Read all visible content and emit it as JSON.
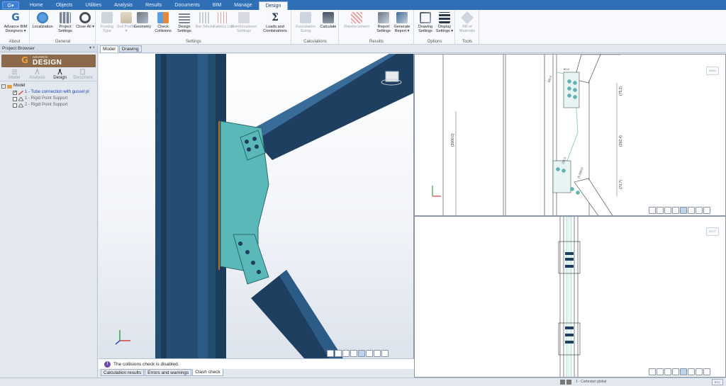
{
  "app": {
    "menu_button": "G▾"
  },
  "menu": {
    "tabs": [
      "Home",
      "Objects",
      "Utilities",
      "Analysis",
      "Results",
      "Documents",
      "BIM",
      "Manage",
      "Design"
    ],
    "active": "Design"
  },
  "ribbon": {
    "groups": [
      {
        "label": "About",
        "buttons": [
          {
            "label": "Advance BIM Designers ▾",
            "icon": "g-logo-icon",
            "enabled": true
          }
        ]
      },
      {
        "label": "General",
        "buttons": [
          {
            "label": "Localization",
            "icon": "globe-icon",
            "enabled": true
          },
          {
            "label": "Project Settings",
            "icon": "building-icon",
            "enabled": true
          },
          {
            "label": "Close All ▾",
            "icon": "power-icon",
            "enabled": true
          }
        ]
      },
      {
        "label": "Settings",
        "buttons": [
          {
            "label": "Footing Type",
            "icon": "footing-icon",
            "enabled": false
          },
          {
            "label": "Soil Profile ▾",
            "icon": "soil-icon",
            "enabled": false
          },
          {
            "label": "Geometry",
            "icon": "geometry-icon",
            "enabled": true
          },
          {
            "label": "Check Collisions",
            "icon": "collision-icon",
            "enabled": true
          },
          {
            "label": "Design Settings",
            "icon": "design-settings-icon",
            "enabled": true
          },
          {
            "label": "Bar Stocks",
            "icon": "bar-stocks-icon",
            "enabled": false
          },
          {
            "label": "Fabrics List",
            "icon": "fabrics-icon",
            "enabled": false
          },
          {
            "label": "Reinforcement Settings",
            "icon": "reinforcement-settings-icon",
            "enabled": false
          },
          {
            "label": "Loads and Combinations",
            "icon": "sigma-icon",
            "enabled": true
          }
        ]
      },
      {
        "label": "Calculations",
        "buttons": [
          {
            "label": "Foundation Sizing",
            "icon": "foundation-icon",
            "enabled": false
          },
          {
            "label": "Calculate",
            "icon": "calculator-icon",
            "enabled": true
          }
        ]
      },
      {
        "label": "Results",
        "buttons": [
          {
            "label": "Reinforcement",
            "icon": "reinforcement-icon",
            "enabled": false
          },
          {
            "label": "Report Settings",
            "icon": "report-settings-icon",
            "enabled": true
          },
          {
            "label": "Generate Report ▾",
            "icon": "report-icon",
            "enabled": true
          }
        ]
      },
      {
        "label": "Options",
        "buttons": [
          {
            "label": "Drawing Settings",
            "icon": "drawing-settings-icon",
            "enabled": true
          },
          {
            "label": "Display Settings ▾",
            "icon": "layers-icon",
            "enabled": true
          }
        ]
      },
      {
        "label": "Tools",
        "buttons": [
          {
            "label": "Bill of Materials",
            "icon": "tag-icon",
            "enabled": false
          }
        ]
      }
    ]
  },
  "project_browser": {
    "title": "Project Browser",
    "pin": "▾ ×",
    "banner_small": "ADVANCE",
    "banner_big": "DESIGN",
    "modes": [
      "Model",
      "Analysis",
      "Design",
      "Document"
    ],
    "active_mode": "Design",
    "tree": [
      {
        "label": "Model",
        "level": 0
      },
      {
        "label": "1 - Tube connection with gusset pl",
        "level": 1
      },
      {
        "label": "1 - Rigid Point Support",
        "level": 1
      },
      {
        "label": "2 - Rigid Point Support",
        "level": 1
      }
    ]
  },
  "view_tabs": [
    "Model",
    "Drawing"
  ],
  "active_view_tab": "Model",
  "drawing": {
    "dimensions": [
      "(3000,0)",
      "(75,2)",
      "(392,4)",
      "(70,7)",
      "60,0",
      "150,0",
      "232,3",
      "(0,2)60,0"
    ],
    "top_hint": "MENU",
    "bottom_hint": "ROOT"
  },
  "messages": {
    "text": "The collisions check is disabled.",
    "icon": "info-icon"
  },
  "bottom_tabs": [
    "Calculation results",
    "Errors and warnings",
    "Clash check"
  ],
  "active_bottom_tab": "Clash check",
  "status": {
    "coord_system": "1 - Cartesian global",
    "tail": "ECC ECC ECC ECC ECC"
  },
  "colors": {
    "menu_bar": "#2f6fb6",
    "steel": "#234e72",
    "plate": "#5bb8b8",
    "member_dark": "#1f3f60"
  }
}
